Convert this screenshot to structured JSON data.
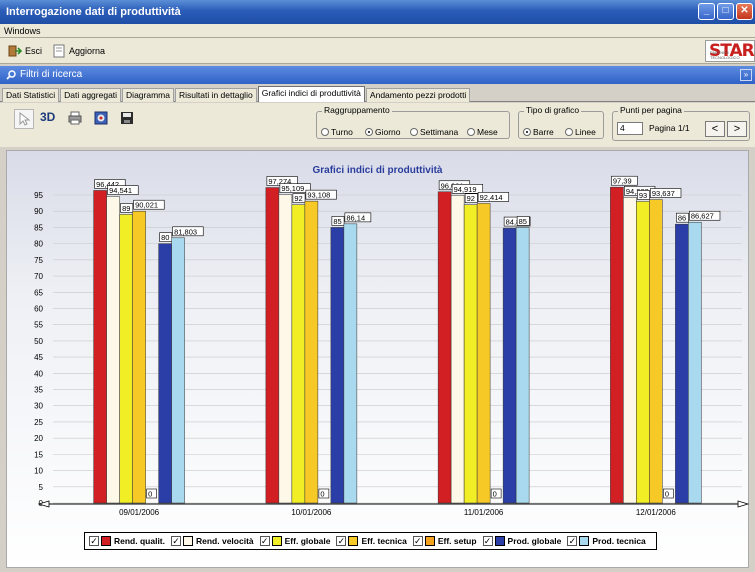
{
  "window": {
    "title": "Interrogazione dati di produttività",
    "menu": [
      "Windows"
    ],
    "controls": [
      "_",
      "□",
      "✕"
    ]
  },
  "toolbar": {
    "exit_label": "Esci",
    "refresh_label": "Aggiorna",
    "logo_text": "STAR",
    "logo_sub": "PARTNER TECNOLOGICO"
  },
  "filter_panel": {
    "title": "Filtri di ricerca",
    "collapse": "»"
  },
  "tabs": [
    {
      "label": "Dati Statistici",
      "active": false
    },
    {
      "label": "Dati aggregati",
      "active": false
    },
    {
      "label": "Diagramma",
      "active": false
    },
    {
      "label": "Risultati in dettaglio",
      "active": false
    },
    {
      "label": "Grafici indici di produttività",
      "active": true
    },
    {
      "label": "Andamento pezzi prodotti",
      "active": false
    }
  ],
  "options": {
    "view_3d_label": "3D",
    "grouping": {
      "label": "Raggruppamento",
      "options": [
        "Turno",
        "Giorno",
        "Settimana",
        "Mese"
      ],
      "selected": "Giorno"
    },
    "chart_type": {
      "label": "Tipo di grafico",
      "options": [
        "Barre",
        "Linee"
      ],
      "selected": "Barre"
    },
    "points_per_page": {
      "label": "Punti per pagina",
      "value": "4",
      "page_label": "Pagina 1/1",
      "prev": "<",
      "next": ">"
    }
  },
  "colors": {
    "rend_qualit": "#d21f23",
    "rend_velocita": "#fdf8e8",
    "eff_globale": "#f2ee26",
    "eff_tecnica": "#f6c927",
    "eff_setup": "#f4a11e",
    "prod_globale": "#2b3ea8",
    "prod_tecnica": "#a9d9ee"
  },
  "chart_data": {
    "type": "bar",
    "title": "Grafici indici di produttività",
    "categories": [
      "09/01/2006",
      "10/01/2006",
      "11/01/2006",
      "12/01/2006"
    ],
    "ylim": [
      0,
      95
    ],
    "yticks": [
      0,
      5,
      10,
      15,
      20,
      25,
      30,
      35,
      40,
      45,
      50,
      55,
      60,
      65,
      70,
      75,
      80,
      85,
      90,
      95
    ],
    "grid": true,
    "legend_position": "bottom",
    "series": [
      {
        "name": "Rend. qualit.",
        "color": "#d21f23",
        "values": [
          96.4,
          97.3,
          96.0,
          97.4
        ],
        "labels": [
          "96,442",
          "97,274",
          "96,001",
          "97,39"
        ]
      },
      {
        "name": "Rend. velocità",
        "color": "#fdf8e8",
        "values": [
          94.5,
          95.1,
          94.9,
          94.3
        ],
        "labels": [
          "94,541",
          "95,109",
          "94,919",
          "94,282"
        ]
      },
      {
        "name": "Eff. globale",
        "color": "#f2ee26",
        "values": [
          89,
          92,
          92,
          93
        ],
        "labels": [
          "89",
          "92",
          "92",
          "93"
        ]
      },
      {
        "name": "Eff. tecnica",
        "color": "#f6c927",
        "values": [
          90.0,
          93.1,
          92.4,
          93.6
        ],
        "labels": [
          "90,021",
          "93,108",
          "92,414",
          "93,637"
        ]
      },
      {
        "name": "Eff. setup",
        "color": "#f4a11e",
        "values": [
          0,
          0,
          0,
          0
        ],
        "labels": [
          "0",
          "0",
          "0",
          "0"
        ]
      },
      {
        "name": "Prod. globale",
        "color": "#2b3ea8",
        "values": [
          80,
          85,
          84.8,
          86
        ],
        "labels": [
          "80",
          "85",
          "84,84",
          "86"
        ]
      },
      {
        "name": "Prod. tecnica",
        "color": "#a9d9ee",
        "values": [
          81.8,
          86.1,
          85,
          86.6
        ],
        "labels": [
          "81,803",
          "86,14",
          "85",
          "86,627"
        ]
      }
    ]
  }
}
